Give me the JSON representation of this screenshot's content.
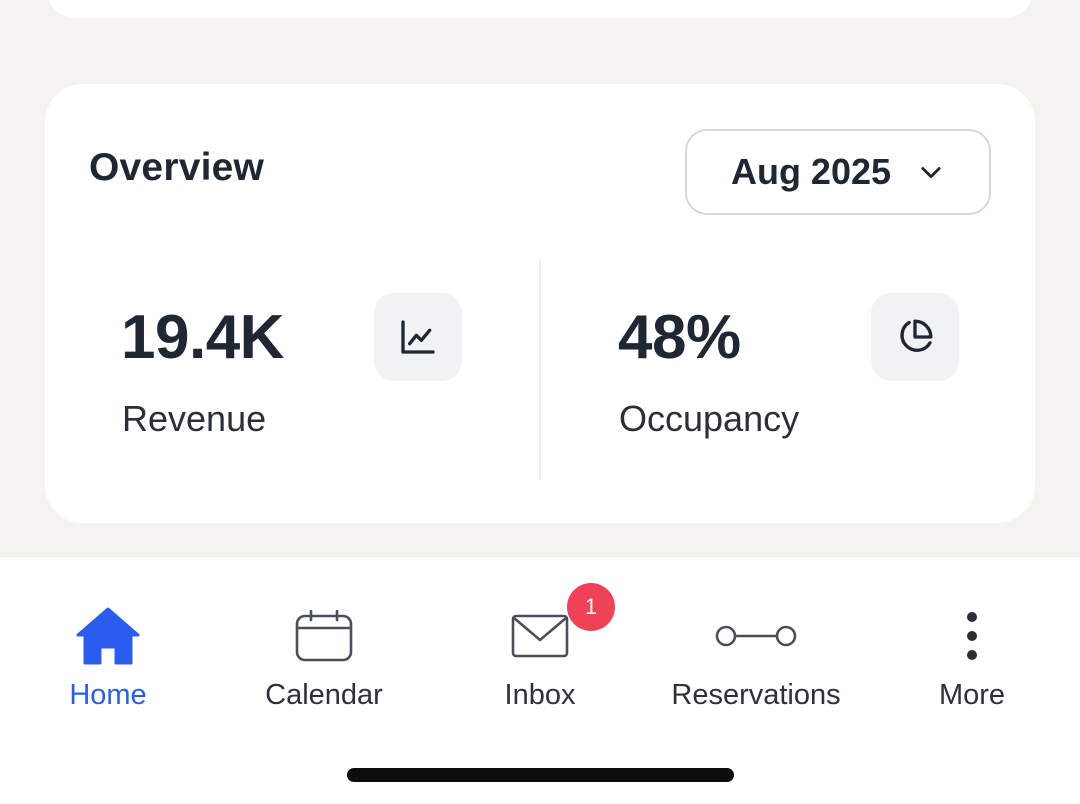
{
  "overview": {
    "title": "Overview",
    "period": "Aug 2025",
    "metrics": [
      {
        "value": "19.4K",
        "label": "Revenue",
        "icon": "line-chart-icon"
      },
      {
        "value": "48%",
        "label": "Occupancy",
        "icon": "pie-chart-icon"
      }
    ]
  },
  "nav": {
    "items": [
      {
        "label": "Home",
        "icon": "home-icon",
        "active": true
      },
      {
        "label": "Calendar",
        "icon": "calendar-icon"
      },
      {
        "label": "Inbox",
        "icon": "mail-icon",
        "badge": "1"
      },
      {
        "label": "Reservations",
        "icon": "reservations-icon"
      },
      {
        "label": "More",
        "icon": "more-vertical-icon"
      }
    ]
  },
  "colors": {
    "accent": "#2b5cf0",
    "badge": "#ef4257",
    "background": "#f4f3f0",
    "card": "#ffffff"
  }
}
